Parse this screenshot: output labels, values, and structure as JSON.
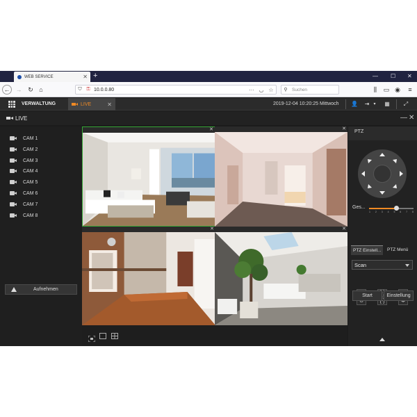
{
  "browser": {
    "tab_title": "WEB SERVICE",
    "new_tab": "+",
    "url": "10.0.0.80",
    "url_more": "···",
    "search_placeholder": "Suchen"
  },
  "app": {
    "title": "VERWALTUNG",
    "live_tab": "LIVE",
    "datetime": "2019-12-04 10:20:25 Mittwoch",
    "section_title": "LIVE",
    "accent_color": "#f08a24",
    "selection_color": "#36a836"
  },
  "cameras": [
    {
      "label": "CAM 1"
    },
    {
      "label": "CAM 2"
    },
    {
      "label": "CAM 3"
    },
    {
      "label": "CAM 4"
    },
    {
      "label": "CAM 5"
    },
    {
      "label": "CAM 6"
    },
    {
      "label": "CAM 7"
    },
    {
      "label": "CAM 8"
    }
  ],
  "record_button": "Aufnehmen",
  "video_tiles": [
    {
      "scene": "living-room",
      "selected": true
    },
    {
      "scene": "empty-room",
      "selected": false
    },
    {
      "scene": "hallway",
      "selected": false
    },
    {
      "scene": "bathroom",
      "selected": false
    }
  ],
  "ptz": {
    "title": "PTZ",
    "speed_label": "Ges...",
    "speed_ticks": [
      "1",
      "2",
      "3",
      "4",
      "5",
      "6",
      "7",
      "8"
    ],
    "speed_value": 5,
    "speed_max": 8,
    "tabs": [
      "PTZ Einstell...",
      "PTZ Menü"
    ],
    "mode_value": "Scan",
    "start_button": "Start",
    "settings_button": "Einstellung"
  }
}
